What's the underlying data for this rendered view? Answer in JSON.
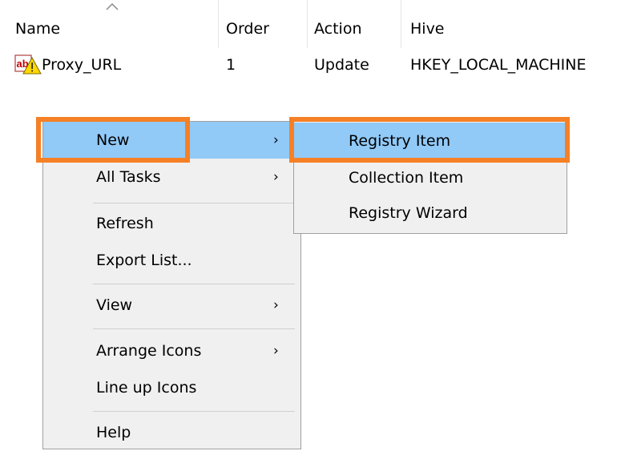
{
  "list": {
    "columns": [
      "Name",
      "Order",
      "Action",
      "Hive"
    ],
    "rows": [
      {
        "name": "Proxy_URL",
        "order": "1",
        "action": "Update",
        "hive": "HKEY_LOCAL_MACHINE"
      }
    ]
  },
  "context_menu": {
    "items": [
      "New",
      "All Tasks",
      "Refresh",
      "Export List...",
      "View",
      "Arrange Icons",
      "Line up Icons",
      "Help"
    ],
    "submenu_arrow": "›"
  },
  "submenu": {
    "items": [
      "Registry Item",
      "Collection Item",
      "Registry Wizard"
    ]
  },
  "colors": {
    "highlight": "#91c9f7",
    "callout": "#f58025",
    "menu_bg": "#f0f0f0"
  },
  "icons": {
    "sort": "sort-ascending-icon",
    "registry_value": "registry-string-value-icon"
  }
}
